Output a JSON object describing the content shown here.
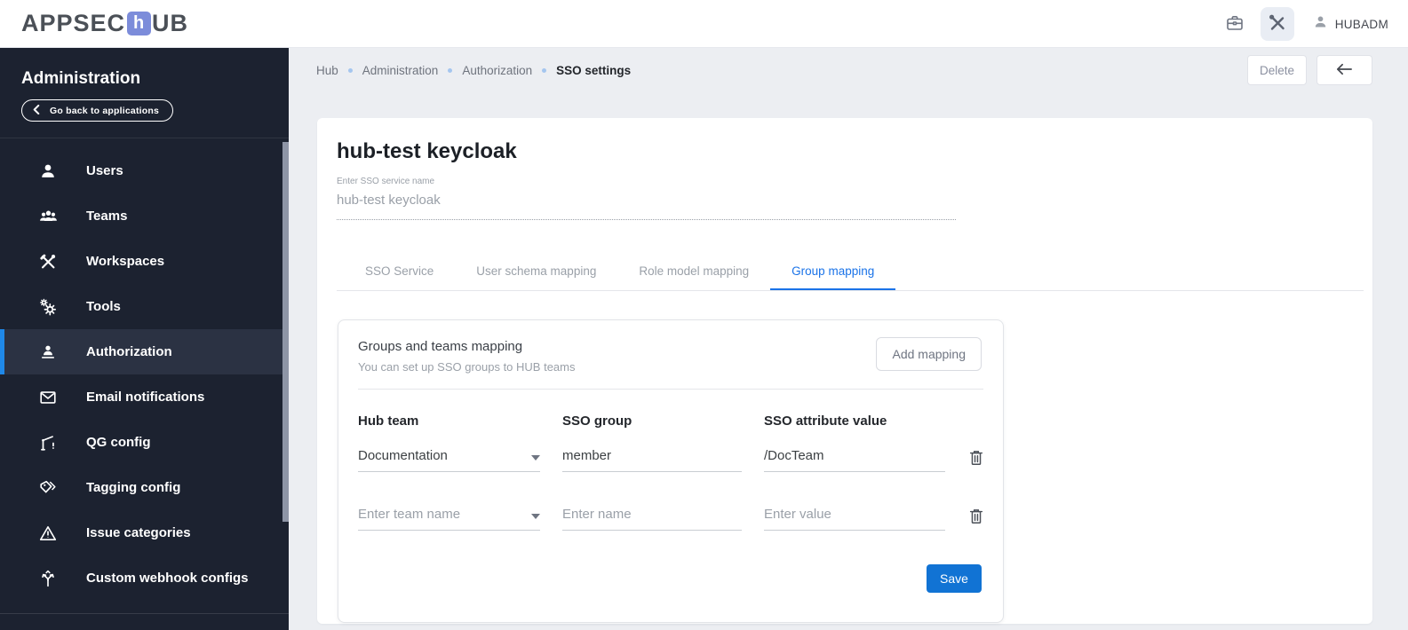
{
  "header": {
    "logo_prefix": "APPSEC",
    "logo_mark_letter": "h",
    "logo_suffix": "UB",
    "icons": {
      "briefcase": "briefcase-icon",
      "tools": "build-tools-icon",
      "user": "person-icon"
    },
    "user_name": "HUBADM"
  },
  "sidebar": {
    "title": "Administration",
    "back_button_label": "Go back to applications",
    "items": [
      {
        "label": "Users",
        "icon": "user-icon",
        "active": false
      },
      {
        "label": "Teams",
        "icon": "group-icon",
        "active": false
      },
      {
        "label": "Workspaces",
        "icon": "construction-icon",
        "active": false
      },
      {
        "label": "Tools",
        "icon": "gears-icon",
        "active": false
      },
      {
        "label": "Authorization",
        "icon": "person-podium-icon",
        "active": true
      },
      {
        "label": "Email notifications",
        "icon": "mail-icon",
        "active": false
      },
      {
        "label": "QG config",
        "icon": "gate-icon",
        "active": false
      },
      {
        "label": "Tagging config",
        "icon": "tag-icon",
        "active": false
      },
      {
        "label": "Issue categories",
        "icon": "warning-triangle-icon",
        "active": false
      },
      {
        "label": "Custom webhook configs",
        "icon": "split-arrows-icon",
        "active": false
      }
    ]
  },
  "breadcrumb": {
    "items": [
      "Hub",
      "Administration",
      "Authorization"
    ],
    "current": "SSO settings"
  },
  "toolbar": {
    "delete_label": "Delete",
    "back_icon": "arrow-left-icon"
  },
  "main": {
    "title": "hub-test keycloak",
    "sso_name_field": {
      "label": "Enter SSO service name",
      "value": "hub-test keycloak"
    },
    "tabs": [
      {
        "label": "SSO Service",
        "active": false
      },
      {
        "label": "User schema mapping",
        "active": false
      },
      {
        "label": "Role model mapping",
        "active": false
      },
      {
        "label": "Group mapping",
        "active": true
      }
    ],
    "card": {
      "title": "Groups and teams mapping",
      "subtitle": "You can set up SSO groups to HUB teams",
      "add_button_label": "Add mapping",
      "columns": [
        "Hub team",
        "SSO group",
        "SSO attribute value"
      ],
      "rows": [
        {
          "hub_team": "Documentation",
          "sso_group": "member",
          "sso_attribute_value": "/DocTeam"
        },
        {
          "hub_team_placeholder": "Enter team name",
          "sso_group_placeholder": "Enter name",
          "sso_attribute_value_placeholder": "Enter value"
        }
      ],
      "row_action_icon": "trash-icon",
      "save_button_label": "Save"
    }
  },
  "colors": {
    "accent_blue": "#1173d4",
    "tab_active_blue": "#1a73e8",
    "sidebar_bg": "#1c2230",
    "sidebar_active_bg": "#2b3243",
    "sidebar_active_border": "#1f88e8",
    "page_bg": "#eceef2",
    "logo_mark_bg": "#7c8cda",
    "breadcrumb_dot": "#a5c6ef"
  }
}
